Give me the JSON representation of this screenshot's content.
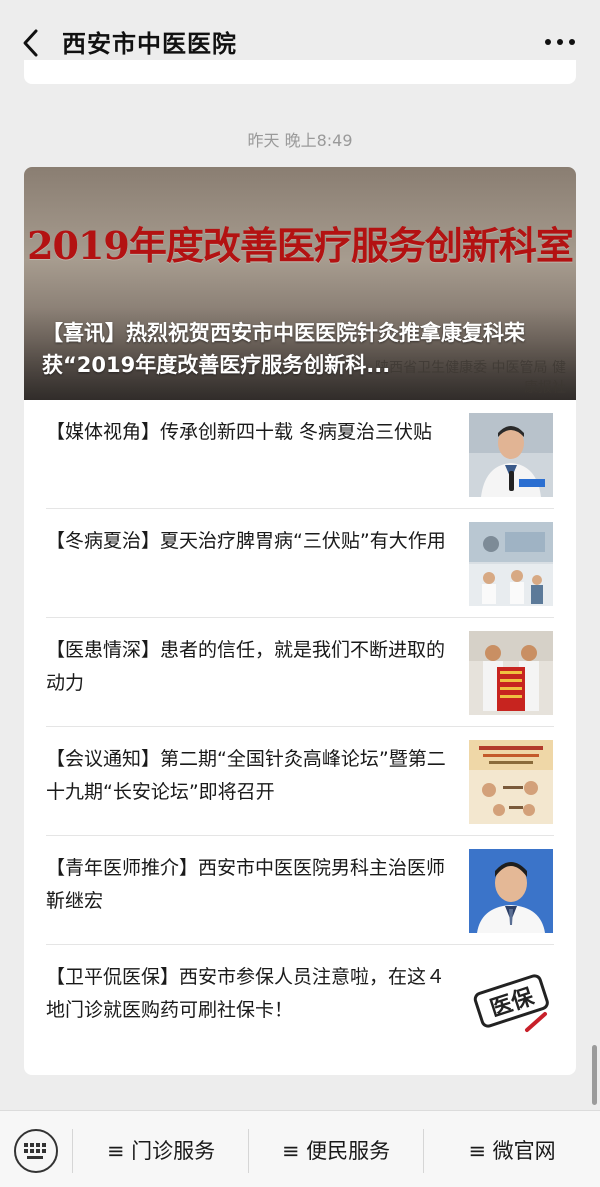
{
  "header": {
    "title": "西安市中医医院",
    "back_icon": "chevron-left-icon",
    "more_icon": "more-dots-icon"
  },
  "timestamp": "昨天 晚上8:49",
  "featured": {
    "banner_text": "2019年度改善医疗服务创新科室",
    "watermark": "陕西省卫生健康委 中医管局 健康报社",
    "title": "【喜讯】热烈祝贺西安市中医医院针灸推拿康复科荣获“2019年度改善医疗服务创新科..."
  },
  "articles": [
    {
      "title": "【媒体视角】传承创新四十载 冬病夏治三伏贴",
      "thumb": "doctor-interview"
    },
    {
      "title": "【冬病夏治】夏天治疗脾胃病“三伏贴”有大作用",
      "thumb": "clinic-scene"
    },
    {
      "title": "【医患情深】患者的信任，就是我们不断进取的动力",
      "thumb": "banner-gift"
    },
    {
      "title": "【会议通知】第二期“全国针灸高峰论坛”暨第二十九期“长安论坛”即将召开",
      "thumb": "forum-poster"
    },
    {
      "title": "【青年医师推介】西安市中医医院男科主治医师靳继宏",
      "thumb": "doctor-portrait"
    },
    {
      "title": "【卫平侃医保】西安市参保人员注意啦，在这４地门诊就医购药可刷社保卡！",
      "thumb": "medical-insurance-logo"
    }
  ],
  "thumb_texts": {
    "insurance_logo": "医保"
  },
  "bottom_menu": {
    "keyboard_icon": "keyboard-icon",
    "items": [
      {
        "label": "≡ 门诊服务"
      },
      {
        "label": "≡ 便民服务"
      },
      {
        "label": "≡ 微官网"
      }
    ]
  },
  "colors": {
    "background": "#ededed",
    "banner_red": "#b31212",
    "text": "#1a1a1a",
    "muted": "#9a9a9a"
  }
}
